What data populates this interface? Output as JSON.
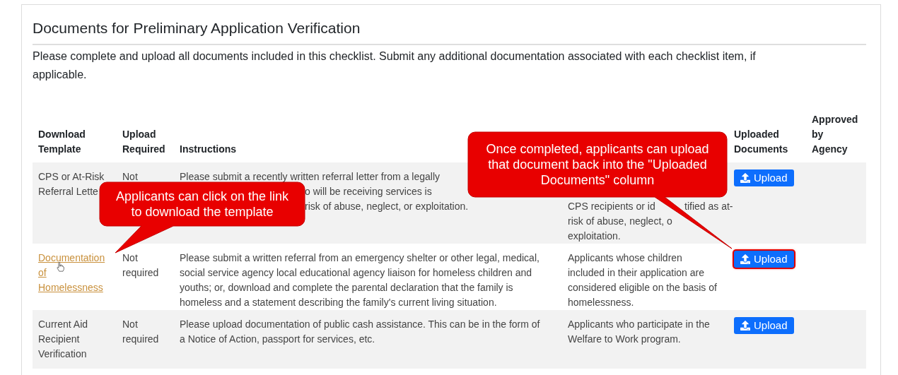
{
  "title": "Documents for Preliminary Application Verification",
  "intro": "Please complete and upload all documents included in this checklist. Submit any additional documentation associated with each checklist item, if applicable.",
  "columns": [
    {
      "label": "Download Template",
      "covered": false
    },
    {
      "label": "Upload Required",
      "covered": false
    },
    {
      "label": "Instructions",
      "covered": false
    },
    {
      "covered": true
    },
    {
      "label": "Uploaded Documents",
      "covered": false
    },
    {
      "label": "Approved by Agency",
      "covered": false
    }
  ],
  "rows": [
    {
      "template": {
        "kind": "text",
        "lines": [
          "CPS or At-Risk",
          "Referral Lette"
        ]
      },
      "required": [
        "Not"
      ],
      "instructions": [
        {
          "text": "Please submit a recently written referral letter from a legally",
          "kind": "line"
        },
        {
          "text": "o will be receiving services is",
          "kind": "after-callout"
        },
        {
          "text": "risk of abuse, neglect, or exploitation.",
          "kind": "after-callout"
        }
      ],
      "who": [
        {
          "text": "CPS recipients or id",
          "rest": "tified as at-",
          "kind": "below-callout"
        },
        {
          "text": "risk of abuse, neglect, o",
          "kind": "line"
        },
        {
          "text": "exploitation.",
          "kind": "line"
        }
      ],
      "upload": {
        "label": "Upload",
        "highlighted": false
      },
      "shaded": true
    },
    {
      "template": {
        "kind": "link",
        "lines": [
          "Documentation of Homelessness"
        ]
      },
      "required": [
        "Not required"
      ],
      "instructions": [
        {
          "text": "Please submit a written referral from an emergency shelter or other legal, medical, social service agency local educational agency liaison for homeless children and youths; or, download and complete the parental declaration that the family is homeless and a statement describing the family's current living situation.",
          "kind": "line"
        }
      ],
      "who": [
        {
          "text": "Applicants whose children included in their application are considered eligible on the basis of homelessness.",
          "kind": "line"
        }
      ],
      "upload": {
        "label": "Upload",
        "highlighted": true
      },
      "shaded": false
    },
    {
      "template": {
        "kind": "text",
        "lines": [
          "Current Aid Recipient Verification"
        ]
      },
      "required": [
        "Not required"
      ],
      "instructions": [
        {
          "text": "Please upload documentation of public cash assistance. This can be in the form of a Notice of Action, passport for services, etc.",
          "kind": "line"
        }
      ],
      "who": [
        {
          "text": "Applicants who participate in the Welfare to Work program.",
          "kind": "line"
        }
      ],
      "upload": {
        "label": "Upload",
        "highlighted": false
      },
      "shaded": true
    }
  ],
  "callouts": [
    "Applicants can click on the link to download the template",
    "Once completed, applicants can upload that document back into the \"Uploaded Documents\" column"
  ]
}
